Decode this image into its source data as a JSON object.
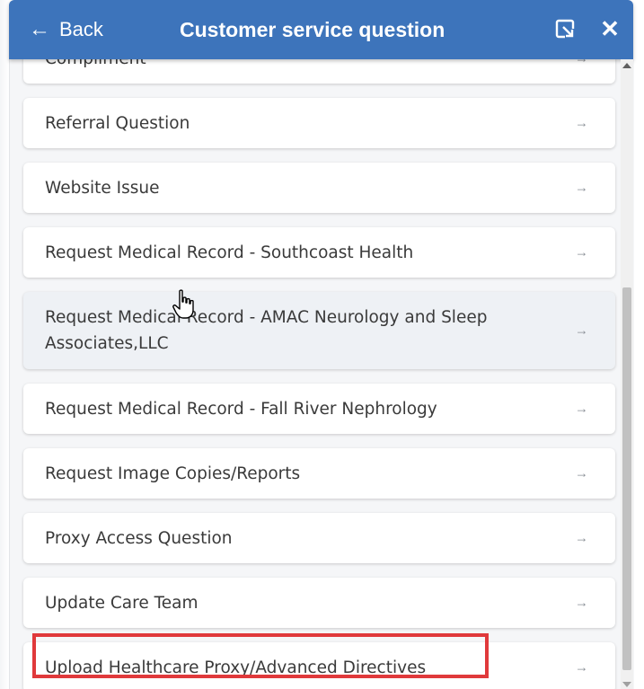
{
  "header": {
    "back_label": "Back",
    "back_icon": "arrow-left-icon",
    "title": "Customer service question",
    "popout_icon": "popout-icon",
    "close_icon": "close-icon",
    "close_glyph": "✕"
  },
  "list": {
    "arrow_glyph": "→",
    "items": [
      {
        "label": "Compliment"
      },
      {
        "label": "Referral Question"
      },
      {
        "label": "Website Issue"
      },
      {
        "label": "Request Medical Record - Southcoast Health"
      },
      {
        "label": "Request Medical Record - AMAC Neurology and Sleep Associates,LLC"
      },
      {
        "label": "Request Medical Record - Fall River Nephrology"
      },
      {
        "label": "Request Image Copies/Reports"
      },
      {
        "label": "Proxy Access Question"
      },
      {
        "label": "Update Care Team"
      },
      {
        "label": "Upload Healthcare Proxy/Advanced Directives"
      }
    ]
  },
  "colors": {
    "header_bg": "#3d74bb",
    "highlight": "#e0393b",
    "panel_bg": "#f5f6f8"
  }
}
